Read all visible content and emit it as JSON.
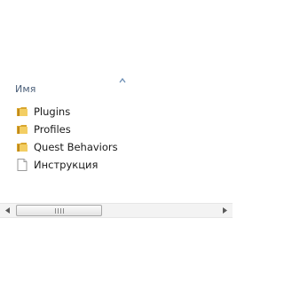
{
  "columns": {
    "name_header": "Имя",
    "sort_direction": "ascending"
  },
  "files": [
    {
      "label": "Plugins",
      "type": "folder",
      "icon": "folder-icon"
    },
    {
      "label": "Profiles",
      "type": "folder",
      "icon": "folder-icon"
    },
    {
      "label": "Quest Behaviors",
      "type": "folder",
      "icon": "folder-icon"
    },
    {
      "label": "Инструкция",
      "type": "document",
      "icon": "document-icon"
    }
  ],
  "colors": {
    "header_text": "#4c607a",
    "folder_yellow": "#e8b53a",
    "sort_arrow": "#6d8fb5"
  }
}
